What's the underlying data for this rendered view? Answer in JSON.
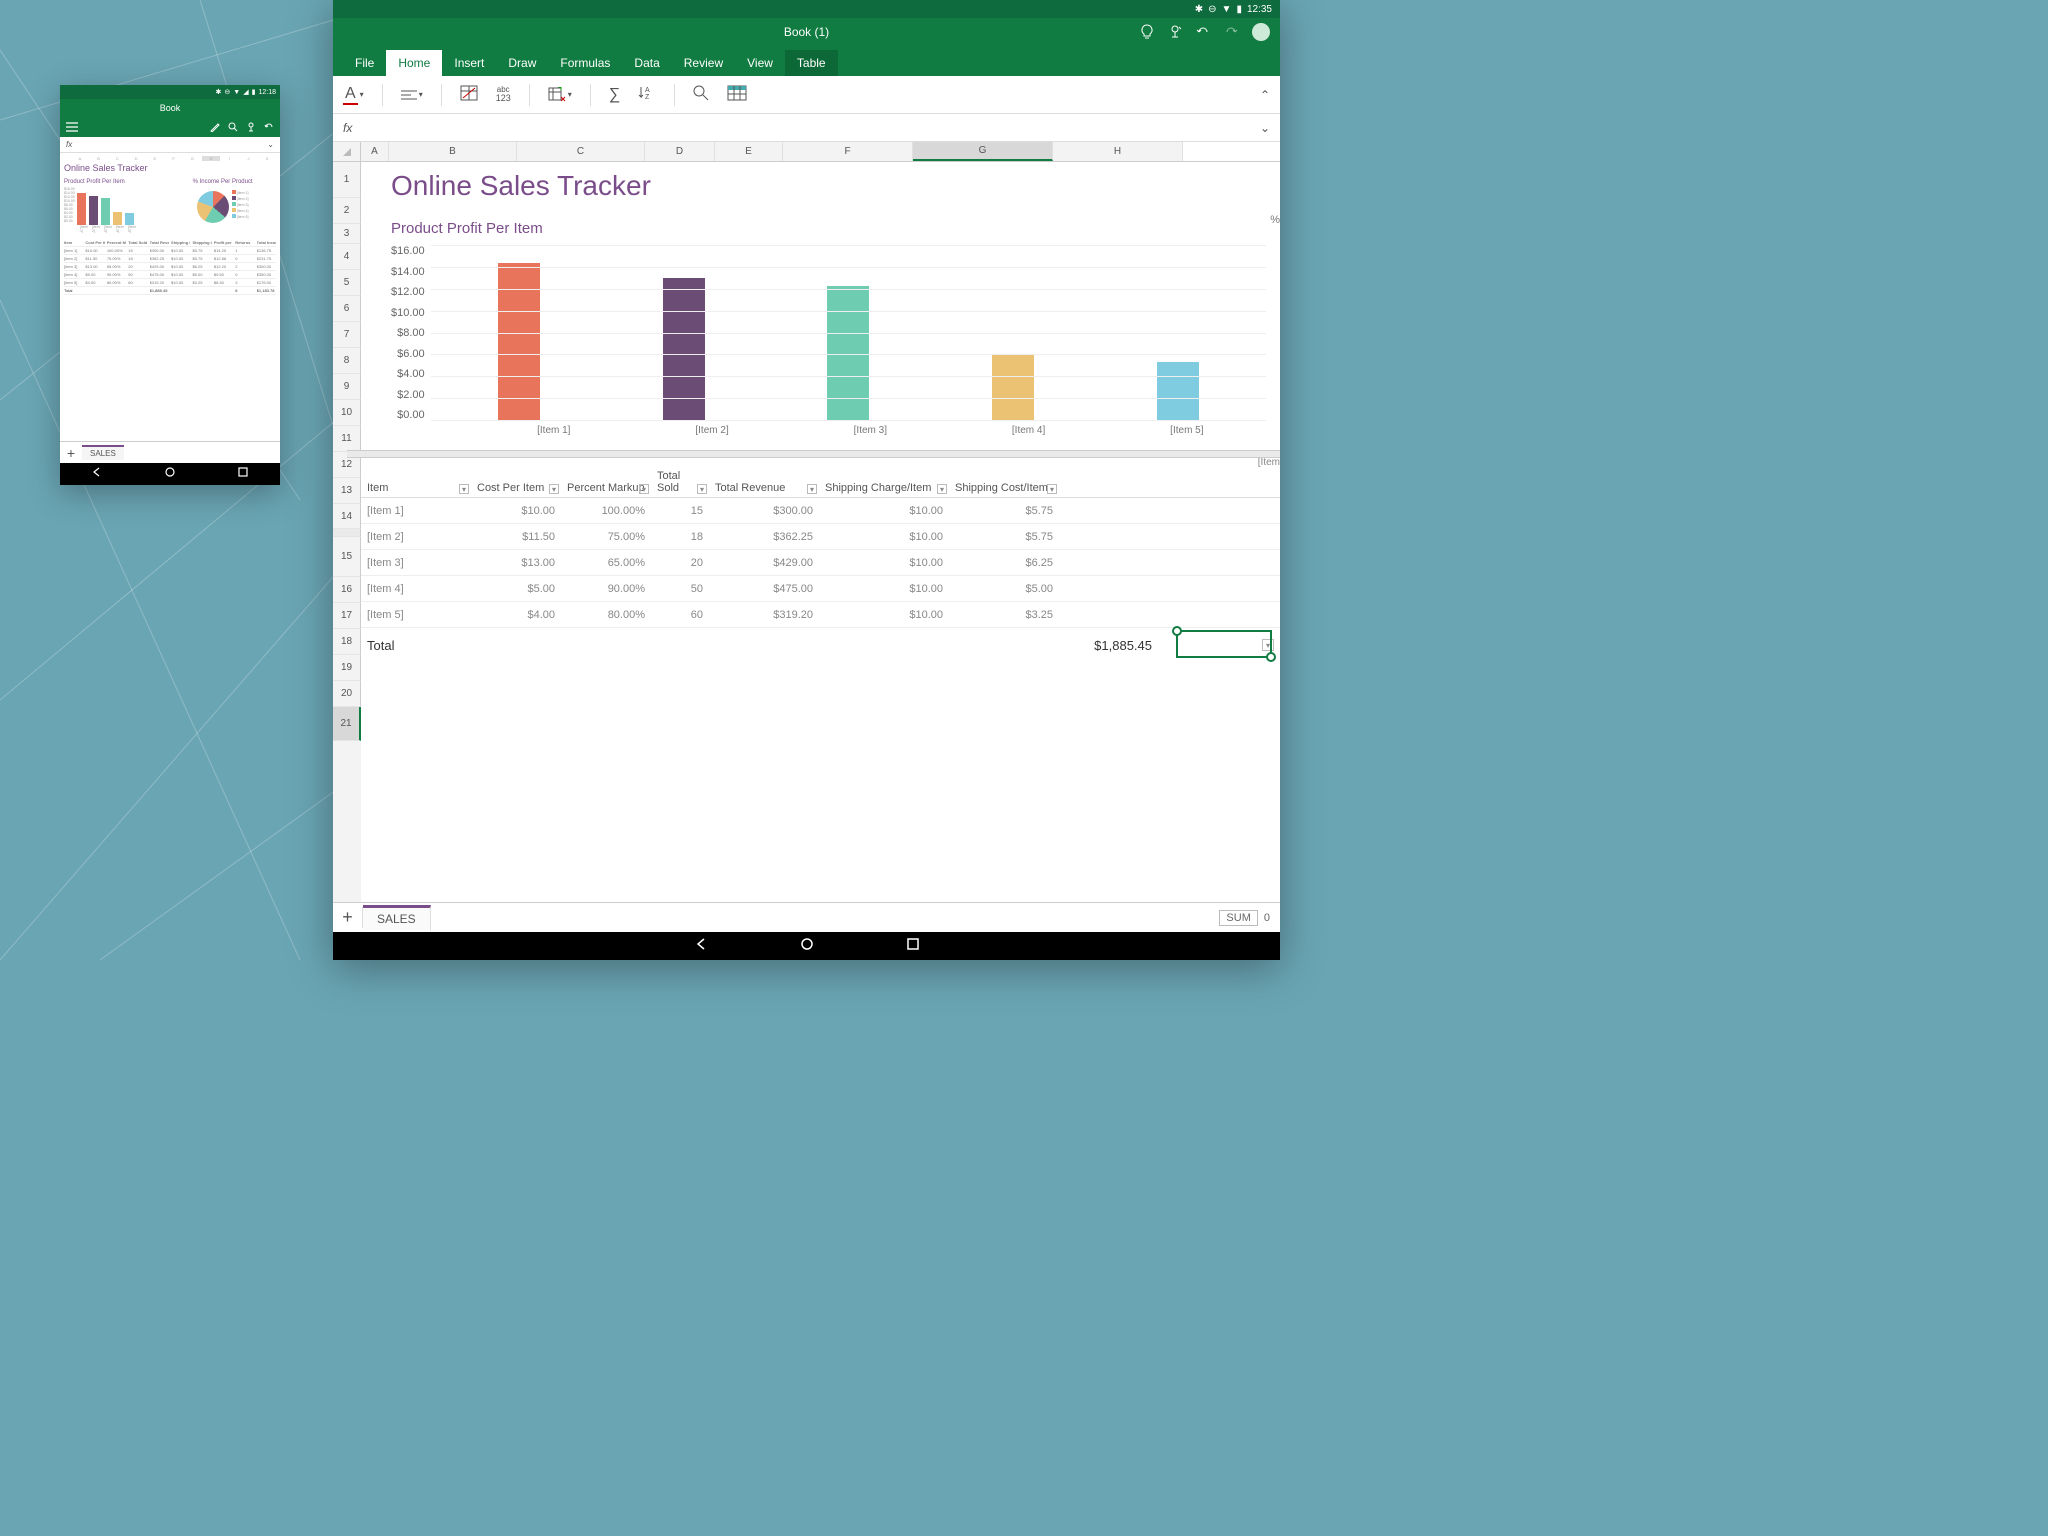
{
  "phone": {
    "time": "12:18",
    "title": "Book",
    "fx": "fx",
    "sheet_title": "Online Sales Tracker",
    "chart1_title": "Product Profit Per Item",
    "chart2_title": "% Income Per Product",
    "tab": "SALES",
    "axis": [
      "$16.00",
      "$14.00",
      "$12.00",
      "$10.00",
      "$8.00",
      "$6.00",
      "$4.00",
      "$2.00",
      "$0.00"
    ],
    "cats": [
      "[Item 1]",
      "[Item 2]",
      "[Item 3]",
      "[Item 4]",
      "[Item 5]"
    ],
    "legend": [
      "[Item 1]",
      "[Item 2]",
      "[Item 3]",
      "[Item 4]",
      "[Item 5]"
    ],
    "table_headers": [
      "Item",
      "Cost Per Item",
      "Percent Markup",
      "Total Sold",
      "Total Revenue",
      "Shipping Charge/Item",
      "Shipping Cost/Item",
      "Profit per Item (incl. shipping)",
      "Returns",
      "Total Income"
    ],
    "rows": [
      [
        "[Item 1]",
        "$10.00",
        "100.00%",
        "15",
        "$300.00",
        "$10.00",
        "$5.75",
        "$14.25",
        "1",
        "$136.75"
      ],
      [
        "[Item 2]",
        "$11.50",
        "75.00%",
        "18",
        "$362.25",
        "$10.00",
        "$5.75",
        "$12.88",
        "0",
        "$231.75"
      ],
      [
        "[Item 3]",
        "$13.00",
        "65.00%",
        "20",
        "$429.00",
        "$10.00",
        "$6.25",
        "$12.20",
        "2",
        "$300.00"
      ],
      [
        "[Item 4]",
        "$5.00",
        "90.00%",
        "50",
        "$475.00",
        "$10.00",
        "$5.00",
        "$9.50",
        "0",
        "$350.00"
      ],
      [
        "[Item 5]",
        "$4.00",
        "80.00%",
        "60",
        "$319.20",
        "$10.00",
        "$3.25",
        "$6.30",
        "3",
        "$176.00"
      ]
    ],
    "total_label": "Total",
    "total_revenue": "$1,885.45",
    "total_returns": "6",
    "total_income": "$1,183.78"
  },
  "tablet": {
    "time": "12:35",
    "title": "Book (1)",
    "tabs": [
      "File",
      "Home",
      "Insert",
      "Draw",
      "Formulas",
      "Data",
      "Review",
      "View",
      "Table"
    ],
    "active_tab": "Home",
    "highlight_tab": "Table",
    "fx": "fx",
    "columns": [
      "A",
      "B",
      "C",
      "D",
      "E",
      "F",
      "G",
      "H"
    ],
    "sel_col": "G",
    "rows_left": [
      "1",
      "2",
      "3",
      "4",
      "5",
      "6",
      "7",
      "8",
      "9",
      "10",
      "11",
      "12",
      "13",
      "14"
    ],
    "rows_left2": [
      "15",
      "16",
      "17",
      "18",
      "19",
      "20",
      "21"
    ],
    "sheet_title": "Online Sales Tracker",
    "chart_title": "Product Profit Per Item",
    "peek1": "%",
    "peek2": "[Item",
    "table": {
      "headers": [
        "Item",
        "Cost Per Item",
        "Percent Markup",
        "Total Sold",
        "Total Revenue",
        "Shipping Charge/Item",
        "Shipping Cost/Item"
      ],
      "rows": [
        [
          "[Item 1]",
          "$10.00",
          "100.00%",
          "15",
          "$300.00",
          "$10.00",
          "$5.75"
        ],
        [
          "[Item 2]",
          "$11.50",
          "75.00%",
          "18",
          "$362.25",
          "$10.00",
          "$5.75"
        ],
        [
          "[Item 3]",
          "$13.00",
          "65.00%",
          "20",
          "$429.00",
          "$10.00",
          "$6.25"
        ],
        [
          "[Item 4]",
          "$5.00",
          "90.00%",
          "50",
          "$475.00",
          "$10.00",
          "$5.00"
        ],
        [
          "[Item 5]",
          "$4.00",
          "80.00%",
          "60",
          "$319.20",
          "$10.00",
          "$3.25"
        ]
      ],
      "total_label": "Total",
      "total_value": "$1,885.45"
    },
    "sheet_tab": "SALES",
    "status_label": "SUM",
    "status_value": "0"
  },
  "chart_data": {
    "type": "bar",
    "title": "Product Profit Per Item",
    "categories": [
      "[Item 1]",
      "[Item 2]",
      "[Item 3]",
      "[Item 4]",
      "[Item 5]"
    ],
    "values": [
      14.25,
      12.88,
      12.2,
      6.0,
      5.3
    ],
    "ylabel": "$",
    "ylim": [
      0,
      16
    ],
    "y_ticks": [
      "$16.00",
      "$14.00",
      "$12.00",
      "$10.00",
      "$8.00",
      "$6.00",
      "$4.00",
      "$2.00",
      "$0.00"
    ],
    "colors": [
      "#e8755b",
      "#6a4c74",
      "#6ecdb0",
      "#ebc174",
      "#7fcce0"
    ]
  }
}
